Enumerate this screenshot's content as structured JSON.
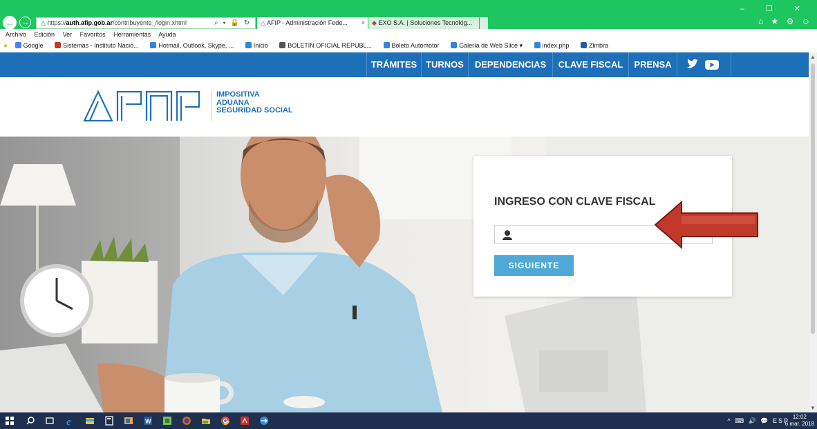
{
  "browser": {
    "address_prefix": "https://",
    "address_host": "auth.afip.gob.ar",
    "address_path": "/contribuyente_/login.xhtml",
    "address_tools": "⌕ ▾ 🔒 ↻",
    "tabs": [
      {
        "label": "AFIP - Administración Fede...",
        "close": "×"
      },
      {
        "label": "EXO S.A. | Soluciones Tecnológ..."
      }
    ],
    "window_controls": "– ❐ ✕",
    "right_icons": "⌂ ★ ⚙ ☺"
  },
  "menu": [
    "Archivo",
    "Edición",
    "Ver",
    "Favoritos",
    "Herramientas",
    "Ayuda"
  ],
  "favorites": [
    {
      "label": "Google",
      "color": "#4285f4"
    },
    {
      "label": "Sistemas - Instituto Nacio...",
      "color": "#c0392b"
    },
    {
      "label": "Hotmail, Outlook, Skype, ...",
      "color": "#2e86de"
    },
    {
      "label": "Inicio",
      "color": "#2e86de"
    },
    {
      "label": "BOLETIN OFICIAL REPUBL...",
      "color": "#555555"
    },
    {
      "label": "Boleto Automotor",
      "color": "#2e86de"
    },
    {
      "label": "Galería de Web Slice ▾",
      "color": "#2e86de"
    },
    {
      "label": "index.php",
      "color": "#2e86de"
    },
    {
      "label": "Zimbra",
      "color": "#1f5fa8"
    }
  ],
  "page": {
    "nav": [
      "TRÁMITES",
      "TURNOS",
      "DEPENDENCIAS",
      "CLAVE FISCAL",
      "PRENSA"
    ],
    "brand_lines": [
      "IMPOSITIVA",
      "ADUANA",
      "SEGURIDAD SOCIAL"
    ],
    "login": {
      "title": "INGRESO CON CLAVE FISCAL",
      "input_placeholder": "",
      "button": "SIGUIENTE"
    }
  },
  "taskbar": {
    "tray": "^ ⌨ 🔊 💬 ESP",
    "time": "12:02",
    "date": "6 mar. 2018"
  },
  "colors": {
    "browser_green": "#1ec65f",
    "afip_blue": "#1d6fb8",
    "button_blue": "#4ea9d6",
    "arrow_red": "#c0392b"
  }
}
